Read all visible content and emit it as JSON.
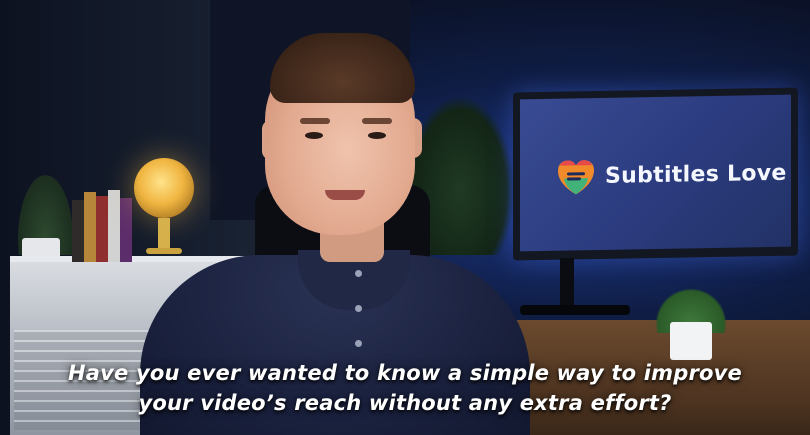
{
  "video": {
    "overlay_brand_text": "Subtitles Love",
    "subtitles": [
      "Have you ever wanted to know a simple way to improve",
      "your video’s reach without any extra effort?"
    ]
  },
  "colors": {
    "screen_blue": "#2b3b7e",
    "subtitle_text": "#ffffff",
    "logo_orange": "#f08a2b",
    "logo_green": "#41b27a",
    "logo_red": "#e84a4a"
  },
  "icons": {
    "logo": "heart-speech-logo-icon"
  }
}
